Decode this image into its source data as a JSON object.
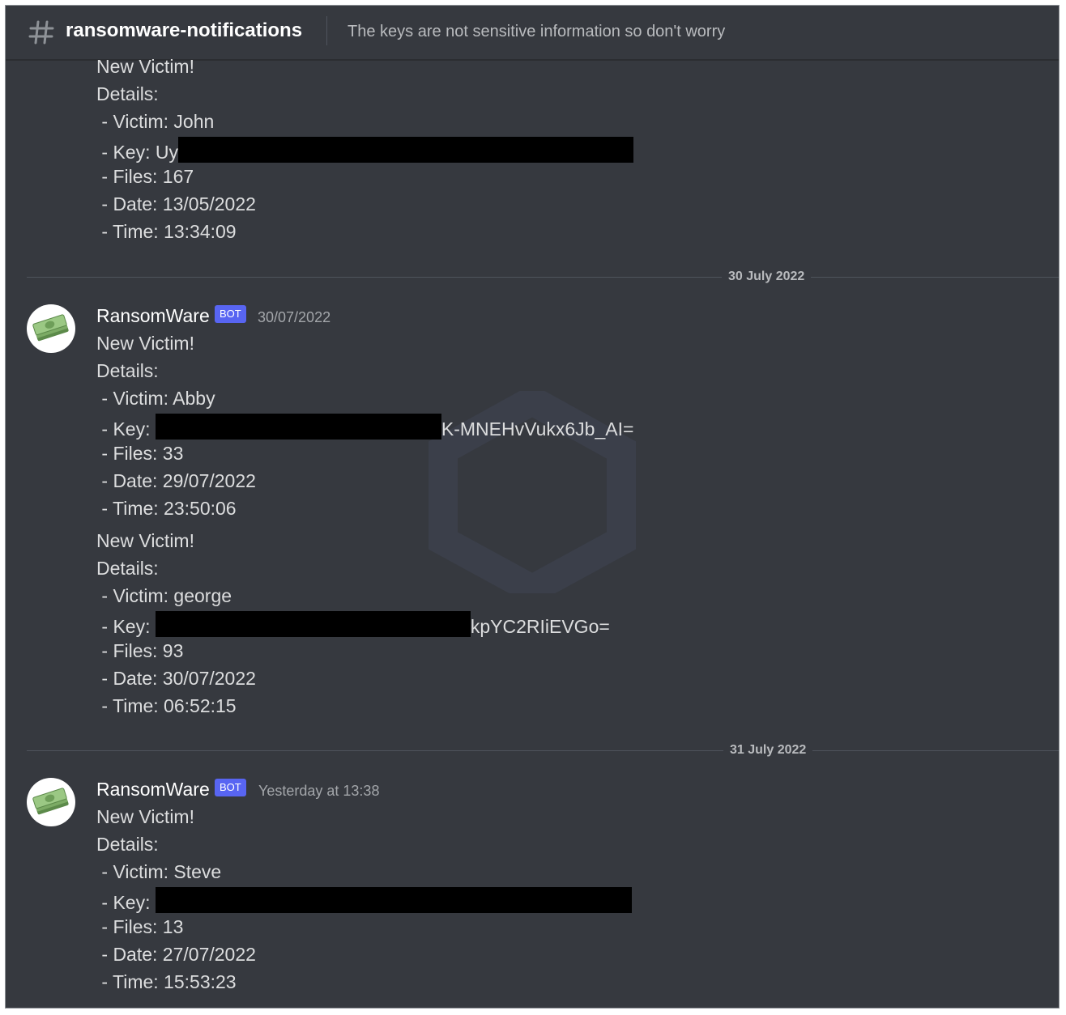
{
  "header": {
    "channel_name": "ransomware-notifications",
    "topic": "The keys are not sensitive information so don't worry",
    "channel_icon": "hash-icon"
  },
  "messages": [
    {
      "lines": {
        "title": "New Victim!",
        "details": "Details:",
        "victim": " - Victim: John",
        "key_prefix": " - Key: Uy",
        "key_suffix": "",
        "files": " - Files: 167",
        "date": " - Date: 13/05/2022",
        "time": " - Time: 13:34:09"
      }
    },
    {
      "date_divider": "30 July 2022",
      "author": "RansomWare",
      "bot_tag": "BOT",
      "timestamp": "30/07/2022",
      "avatar_icon": "money-stack-icon",
      "lines": {
        "title": "New Victim!",
        "details": "Details:",
        "victim": " - Victim: Abby",
        "key_prefix": " - Key: ",
        "key_suffix": "K-MNEHvVukx6Jb_AI=",
        "files": " - Files: 33",
        "date": " - Date: 29/07/2022",
        "time": " - Time: 23:50:06"
      }
    },
    {
      "lines": {
        "title": "New Victim!",
        "details": "Details:",
        "victim": " - Victim: george",
        "key_prefix": " - Key: ",
        "key_suffix": "kpYC2RIiEVGo=",
        "files": " - Files: 93",
        "date": " - Date: 30/07/2022",
        "time": " - Time: 06:52:15"
      }
    },
    {
      "date_divider": "31 July 2022",
      "author": "RansomWare",
      "bot_tag": "BOT",
      "timestamp": "Yesterday at 13:38",
      "avatar_icon": "money-stack-icon",
      "lines": {
        "title": "New Victim!",
        "details": "Details:",
        "victim": " - Victim: Steve",
        "key_prefix": " - Key: ",
        "key_suffix": "",
        "files": " - Files: 13",
        "date": " - Date: 27/07/2022",
        "time": " - Time: 15:53:23"
      }
    }
  ],
  "colors": {
    "background": "#36393f",
    "header_text": "#ffffff",
    "message_text": "#dcddde",
    "muted_text": "#b9bbbe",
    "bot_tag": "#5865f2",
    "redaction": "#000000"
  },
  "decorations": {
    "watermark_icon": "hexagon-watermark-icon"
  }
}
